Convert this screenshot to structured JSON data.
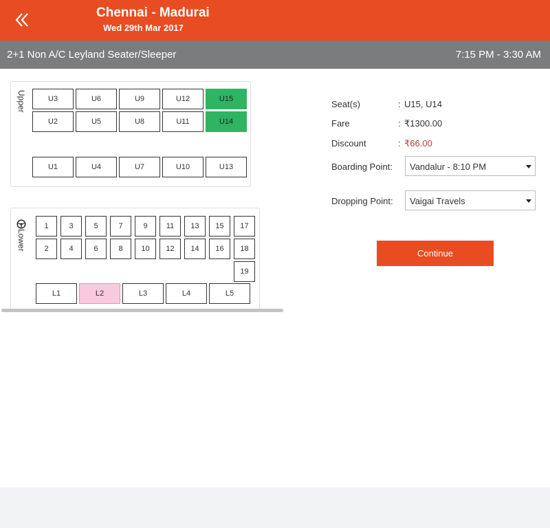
{
  "header": {
    "route": "Chennai - Madurai",
    "date": "Wed 29th Mar 2017",
    "back_icon": "double-chevron-left-icon"
  },
  "subbar": {
    "bus_type": "2+1 Non A/C Leyland Seater/Sleeper",
    "timing": "7:15 PM - 3:30 AM"
  },
  "upper_deck": {
    "label": "Upper",
    "seats": [
      "U3",
      "U6",
      "U9",
      "U12",
      "U15",
      "U2",
      "U5",
      "U8",
      "U11",
      "U14",
      "U1",
      "U4",
      "U7",
      "U10",
      "U13"
    ]
  },
  "lower_deck": {
    "label": "Lower",
    "steering_icon": "steering-wheel-icon",
    "seats": [
      "1",
      "3",
      "5",
      "7",
      "9",
      "11",
      "13",
      "15",
      "17",
      "2",
      "4",
      "6",
      "8",
      "10",
      "12",
      "14",
      "16",
      "18",
      "19"
    ],
    "sleepers": [
      "L1",
      "L2",
      "L3",
      "L4",
      "L5"
    ]
  },
  "legend_colors": {
    "selected": "#2fb461",
    "ladies": "#f9c9de",
    "accent": "#e84c22"
  },
  "summary": {
    "seats_label": "Seat(s)",
    "seats_value": "U15, U14",
    "fare_label": "Fare",
    "fare_value": "₹1300.00",
    "discount_label": "Discount",
    "discount_value": "₹66.00",
    "colon": ":"
  },
  "boarding": {
    "label": "Boarding Point:",
    "value": "Vandalur - 8:10 PM"
  },
  "dropping": {
    "label": "Dropping Point:",
    "value": "Vaigai Travels"
  },
  "continue_label": "Continue"
}
